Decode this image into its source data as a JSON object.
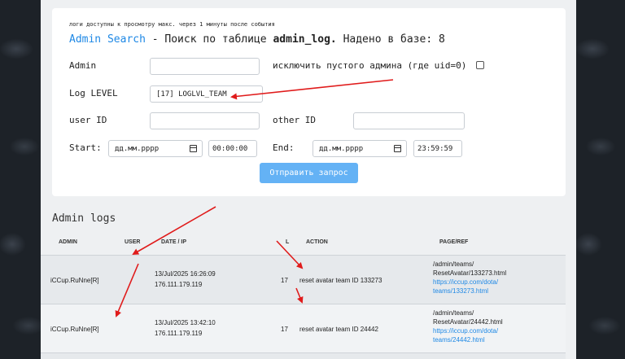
{
  "header": {
    "note": "логи доступны к просмотру макс. через 1 минуты после события",
    "title_app": "Admin Search",
    "title_dash": " - Поиск по таблице ",
    "title_table": "admin_log.",
    "title_found": " Надено в базе: 8"
  },
  "form": {
    "admin_label": "Admin",
    "admin_value": "",
    "exclude_label": "исключить пустого админа (где uid=0)",
    "log_level_label": "Log LEVEL",
    "log_level_value": "[17] LOGLVL_TEAM",
    "user_id_label": "user ID",
    "user_id_value": "",
    "other_id_label": "other ID",
    "other_id_value": "",
    "start_label": "Start:",
    "start_date": "дд.мм.рррр",
    "start_time": "00:00:00",
    "end_label": "End:",
    "end_date": "дд.мм.рррр",
    "end_time": "23:59:59",
    "submit_label": "Отправить запрос"
  },
  "logs": {
    "title": "Admin logs",
    "columns": [
      "ADMIN",
      "USER",
      "DATE / IP",
      "L",
      "ACTION",
      "PAGE/REF"
    ],
    "rows": [
      {
        "admin": "iCCup.RuNne[R]",
        "user": "",
        "date": "13/Jul/2025 16:26:09",
        "ip": "176.111.179.119",
        "level": "17",
        "action": "reset avatar team ID 133273",
        "page1": "/admin/teams/",
        "page2": "ResetAvatar/133273.html",
        "ref1": "https://iccup.com/dota/",
        "ref2": "teams/133273.html"
      },
      {
        "admin": "iCCup.RuNne[R]",
        "user": "",
        "date": "13/Jul/2025 13:42:10",
        "ip": "176.111.179.119",
        "level": "17",
        "action": "reset avatar team ID 24442",
        "page1": "/admin/teams/",
        "page2": "ResetAvatar/24442.html",
        "ref1": "https://iccup.com/dota/",
        "ref2": "teams/24442.html"
      }
    ]
  },
  "colors": {
    "accent": "#1e88e5",
    "button": "#64b2f5",
    "annotation_arrow": "#e01b1b"
  }
}
